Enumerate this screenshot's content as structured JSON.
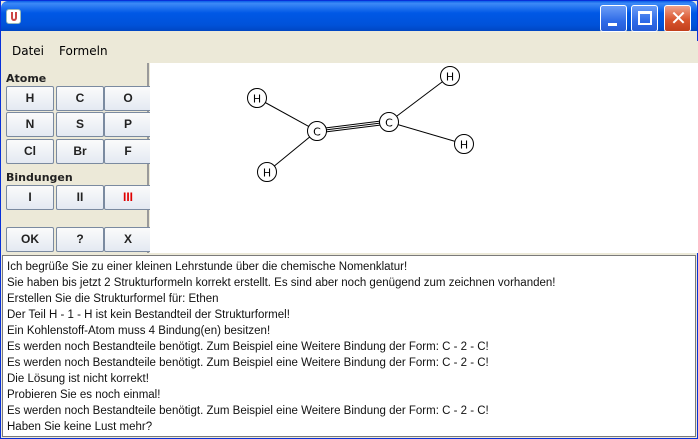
{
  "window": {
    "title": ""
  },
  "menu": {
    "items": [
      "Datei",
      "Formeln"
    ]
  },
  "palette": {
    "atoms_label": "Atome",
    "atoms": [
      "H",
      "C",
      "O",
      "N",
      "S",
      "P",
      "Cl",
      "Br",
      "F"
    ],
    "bonds_label": "Bindungen",
    "bonds": [
      "I",
      "II",
      "III"
    ],
    "actions": [
      "OK",
      "?",
      "X"
    ],
    "selected_bond_color": "#e00000"
  },
  "structure": {
    "atoms": [
      {
        "label": "H",
        "id": "h1"
      },
      {
        "label": "C",
        "id": "c1"
      },
      {
        "label": "C",
        "id": "c2"
      },
      {
        "label": "H",
        "id": "h2"
      },
      {
        "label": "H",
        "id": "h3"
      },
      {
        "label": "H",
        "id": "h4"
      }
    ]
  },
  "log": [
    "Ich begrüße Sie zu einer kleinen Lehrstunde über die chemische Nomenklatur!",
    "Sie haben bis jetzt 2 Strukturformeln korrekt erstellt. Es sind aber noch genügend zum zeichnen vorhanden!",
    "Erstellen Sie die Strukturformel für: Ethen",
    "Der Teil H - 1 - H ist kein Bestandteil der Strukturformel!",
    "Ein Kohlenstoff-Atom muss 4 Bindung(en) besitzen!",
    "Es werden noch Bestandteile benötigt. Zum Beispiel eine Weitere Bindung der Form: C - 2 - C!",
    "Es werden noch Bestandteile benötigt. Zum Beispiel eine Weitere Bindung der Form: C - 2 - C!",
    "Die Lösung ist nicht korrekt!",
    "Probieren Sie es noch einmal!",
    "Es werden noch Bestandteile benötigt. Zum Beispiel eine Weitere Bindung der Form: C - 2 - C!",
    "Haben Sie keine Lust mehr?"
  ]
}
